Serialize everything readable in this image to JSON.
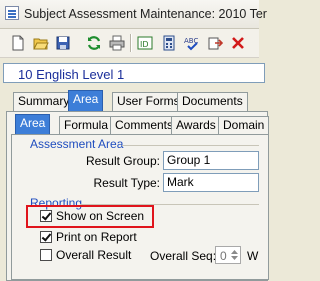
{
  "window": {
    "title": "Subject Assessment Maintenance: 2010 Ter"
  },
  "toolbar": {
    "buttons": [
      "new-document-icon",
      "open-folder-icon",
      "save-disk-icon",
      "refresh-icon",
      "print-icon",
      "edit-id-icon",
      "calculator-icon",
      "spell-check-icon",
      "export-icon",
      "delete-icon"
    ]
  },
  "record": {
    "value": "10 English Level 1"
  },
  "main_tabs": [
    "Summary",
    "Area",
    "User Forms",
    "Documents"
  ],
  "sub_tabs": [
    "Area",
    "Formula",
    "Comments",
    "Awards",
    "Domain"
  ],
  "assessment_area": {
    "title": "Assessment Area",
    "result_group_label": "Result Group:",
    "result_group_value": "Group 1",
    "result_type_label": "Result Type:",
    "result_type_value": "Mark"
  },
  "reporting": {
    "title": "Reporting",
    "show_on_screen": {
      "label": "Show on Screen",
      "checked": true
    },
    "print_on_report": {
      "label": "Print on Report",
      "checked": true
    },
    "overall_result": {
      "label": "Overall Result",
      "checked": false
    },
    "overall_seq_label": "Overall Seq:",
    "overall_seq_value": "0",
    "trailing_label": "W"
  },
  "colors": {
    "accent": "#3d7ed8",
    "highlight": "#e0141c",
    "record_text": "#1a2e9a"
  }
}
